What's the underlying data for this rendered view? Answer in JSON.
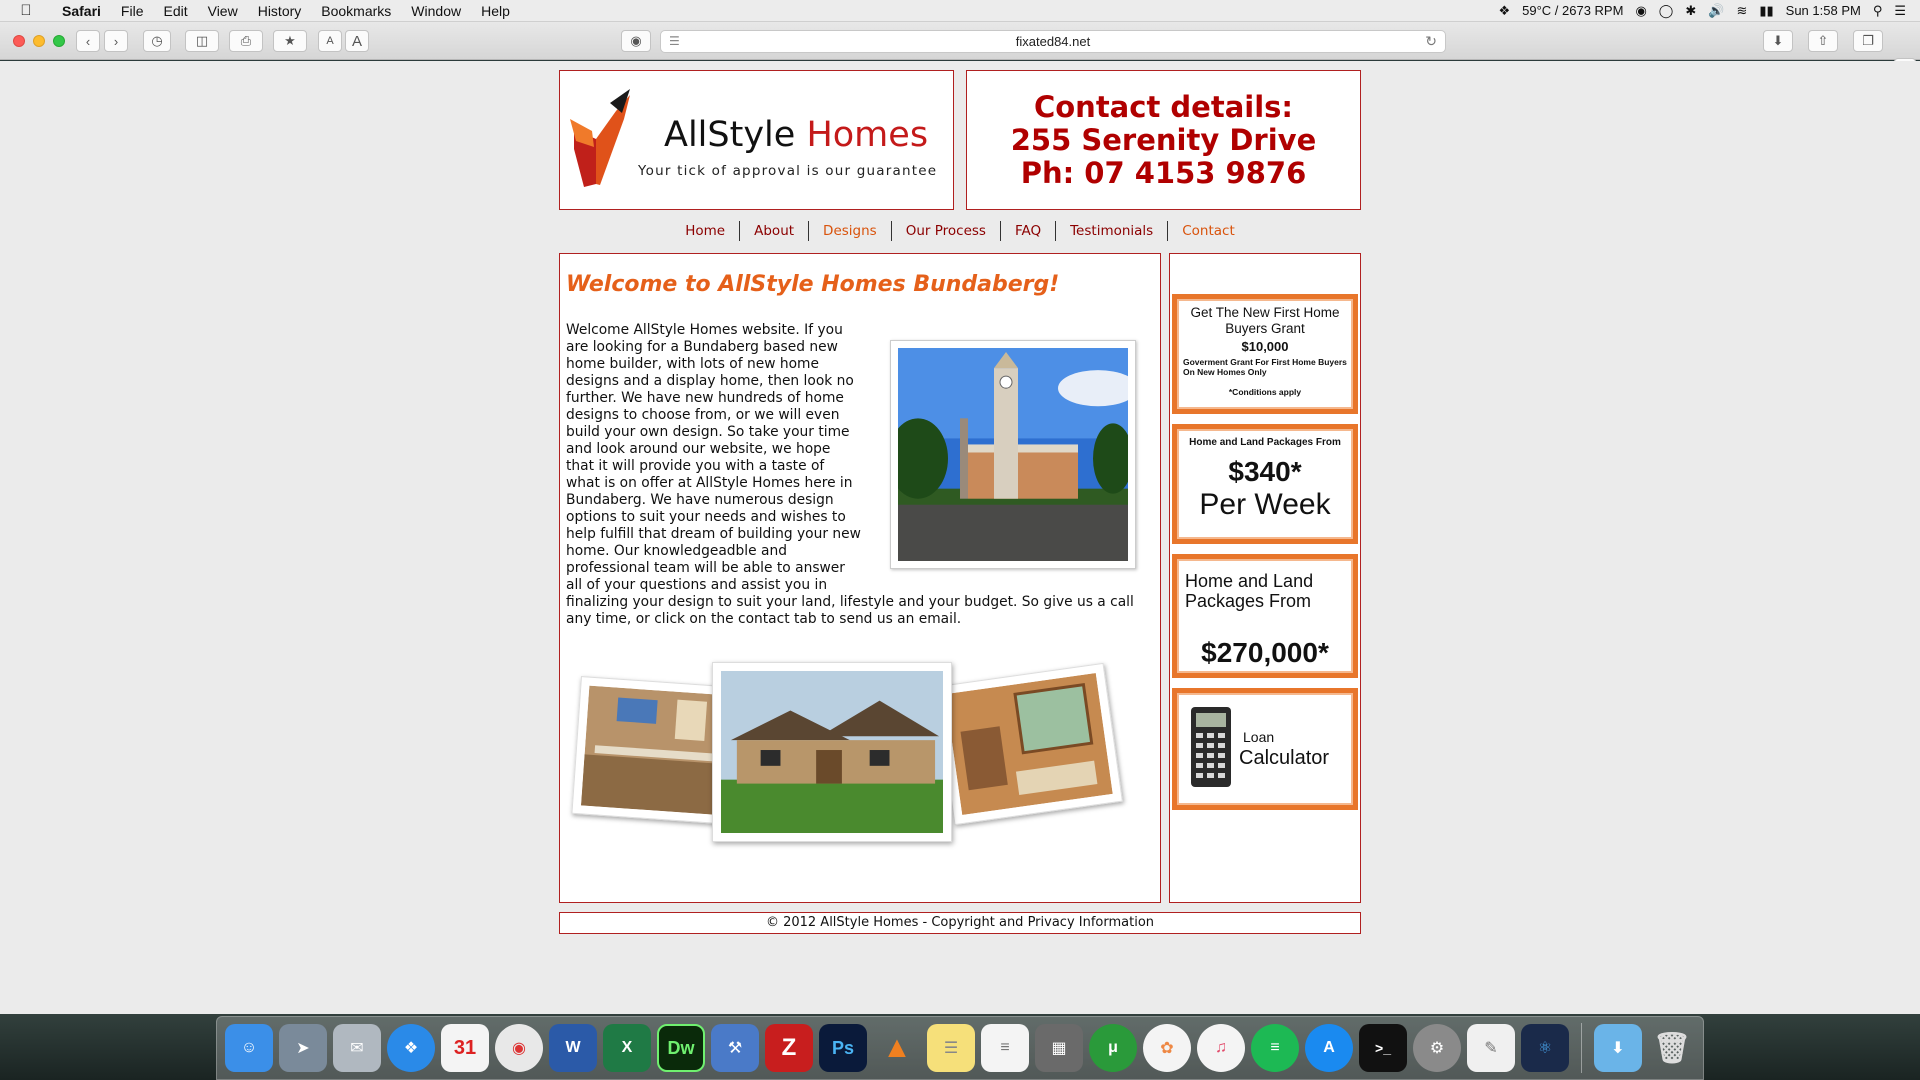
{
  "menubar": {
    "app_name": "Safari",
    "menus": [
      "File",
      "Edit",
      "View",
      "History",
      "Bookmarks",
      "Window",
      "Help"
    ],
    "status_temp": "59°C / 2673 RPM",
    "clock": "Sun 1:58 PM"
  },
  "browser": {
    "url": "fixated84.net",
    "font_small": "A",
    "font_large": "A"
  },
  "site": {
    "logo": {
      "brand_first": "AllStyle",
      "brand_second": "Homes",
      "tagline": "Your tick of approval is our guarantee"
    },
    "contact": {
      "line1": "Contact details:",
      "line2": "255 Serenity Drive",
      "line3": "Ph: 07 4153 9876"
    },
    "nav": [
      "Home",
      "About",
      "Designs",
      "Our Process",
      "FAQ",
      "Testimonials",
      "Contact"
    ],
    "main": {
      "heading": "Welcome to AllStyle Homes Bundaberg!",
      "body": "Welcome AllStyle Homes website. If you are looking for a Bundaberg based new home builder, with lots of new home designs and a display home, then look no further. We have new hundreds of home designs to choose from, or we will even build your own design. So take your time and look around our website, we hope that it will provide you with a taste of what is on offer at AllStyle Homes here in Bundaberg. We have numerous design options to suit your needs and wishes to help fulfill that dream of building your new home. Our knowledgeadble and professional team will be able to answer all of your questions and assist you in finalizing your design to suit your land, lifestyle and your budget. So give us a call any time, or click on the contact tab to send us an email."
    },
    "sidebar": {
      "grant": {
        "line1": "Get The New First Home Buyers Grant",
        "amount": "$10,000",
        "detail": "Goverment Grant For First Home Buyers On New Homes Only",
        "note": "*Conditions apply"
      },
      "weekly": {
        "line1": "Home and Land Packages From",
        "price": "$340*",
        "period": "Per Week"
      },
      "packages": {
        "line1": "Home and Land Packages From",
        "price": "$270,000*"
      },
      "loan": {
        "line1": "Loan",
        "line2": "Calculator"
      }
    },
    "footer": "© 2012 AllStyle Homes - Copyright and Privacy Information"
  },
  "colors": {
    "accent_red": "#b00000",
    "heading_orange": "#e5601a",
    "ad_border": "#e8762b"
  }
}
